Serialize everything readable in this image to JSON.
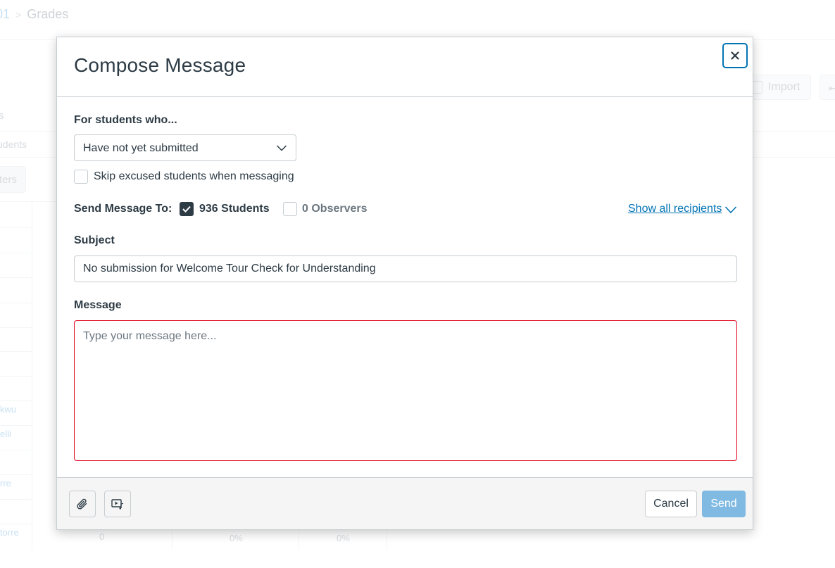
{
  "background": {
    "breadcrumb": {
      "course": "01",
      "current": "Grades"
    },
    "import_label": "Import",
    "side_text_1": "s",
    "side_text_2": "udents",
    "filters_label": "ters",
    "student_names": [
      "kwu",
      "elli",
      "rre",
      "torre"
    ],
    "cells": [
      "0",
      "0%",
      "0%"
    ]
  },
  "modal": {
    "title": "Compose Message",
    "close_label": "×",
    "criteria_label": "For students who...",
    "criteria_selected": "Have not yet submitted",
    "skip_excused_label": "Skip excused students when messaging",
    "skip_excused_checked": false,
    "send_to_label": "Send Message To:",
    "students_label": "936 Students",
    "students_checked": true,
    "observers_label": "0 Observers",
    "observers_checked": false,
    "show_all_label": "Show all recipients",
    "subject_label": "Subject",
    "subject_value": "No submission for Welcome Tour Check for Understanding",
    "message_label": "Message",
    "message_placeholder": "Type your message here...",
    "cancel_label": "Cancel",
    "send_label": "Send"
  },
  "colors": {
    "accent": "#0374b5",
    "error_border": "#e0061f",
    "send_disabled": "#80bae3",
    "text": "#2d3b45"
  },
  "icons": {
    "close": "close-icon",
    "attach": "paperclip-icon",
    "media": "media-upload-icon",
    "select": "chevron-down-icon",
    "check": "checkmark-icon"
  }
}
